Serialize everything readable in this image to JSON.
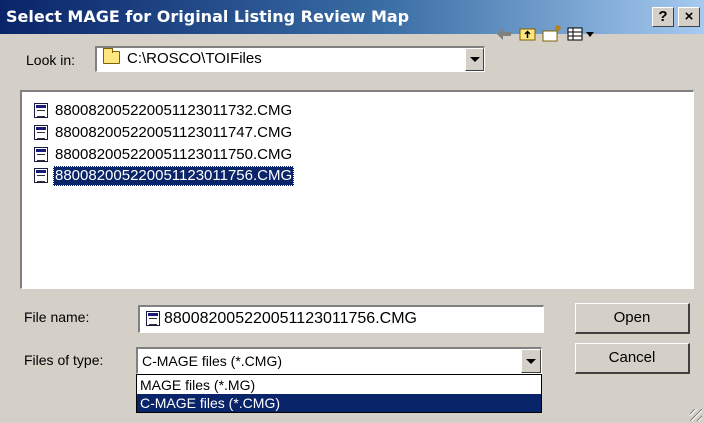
{
  "window": {
    "title": "Select MAGE for Original Listing Review Map",
    "help_label": "?",
    "close_label": "×"
  },
  "look_in": {
    "label": "Look in:",
    "value": "C:\\ROSCO\\TOIFiles"
  },
  "files": [
    {
      "name": "880082005220051123011732.CMG",
      "selected": false
    },
    {
      "name": "880082005220051123011747.CMG",
      "selected": false
    },
    {
      "name": "880082005220051123011750.CMG",
      "selected": false
    },
    {
      "name": "880082005220051123011756.CMG",
      "selected": true
    }
  ],
  "file_name": {
    "label": "File name:",
    "value": "880082005220051123011756.CMG"
  },
  "file_type": {
    "label": "Files of type:",
    "value": "C-MAGE files (*.CMG)",
    "options": [
      "MAGE files (*.MG)",
      "C-MAGE files (*.CMG)"
    ],
    "selected_index": 1
  },
  "buttons": {
    "open": "Open",
    "cancel": "Cancel"
  }
}
